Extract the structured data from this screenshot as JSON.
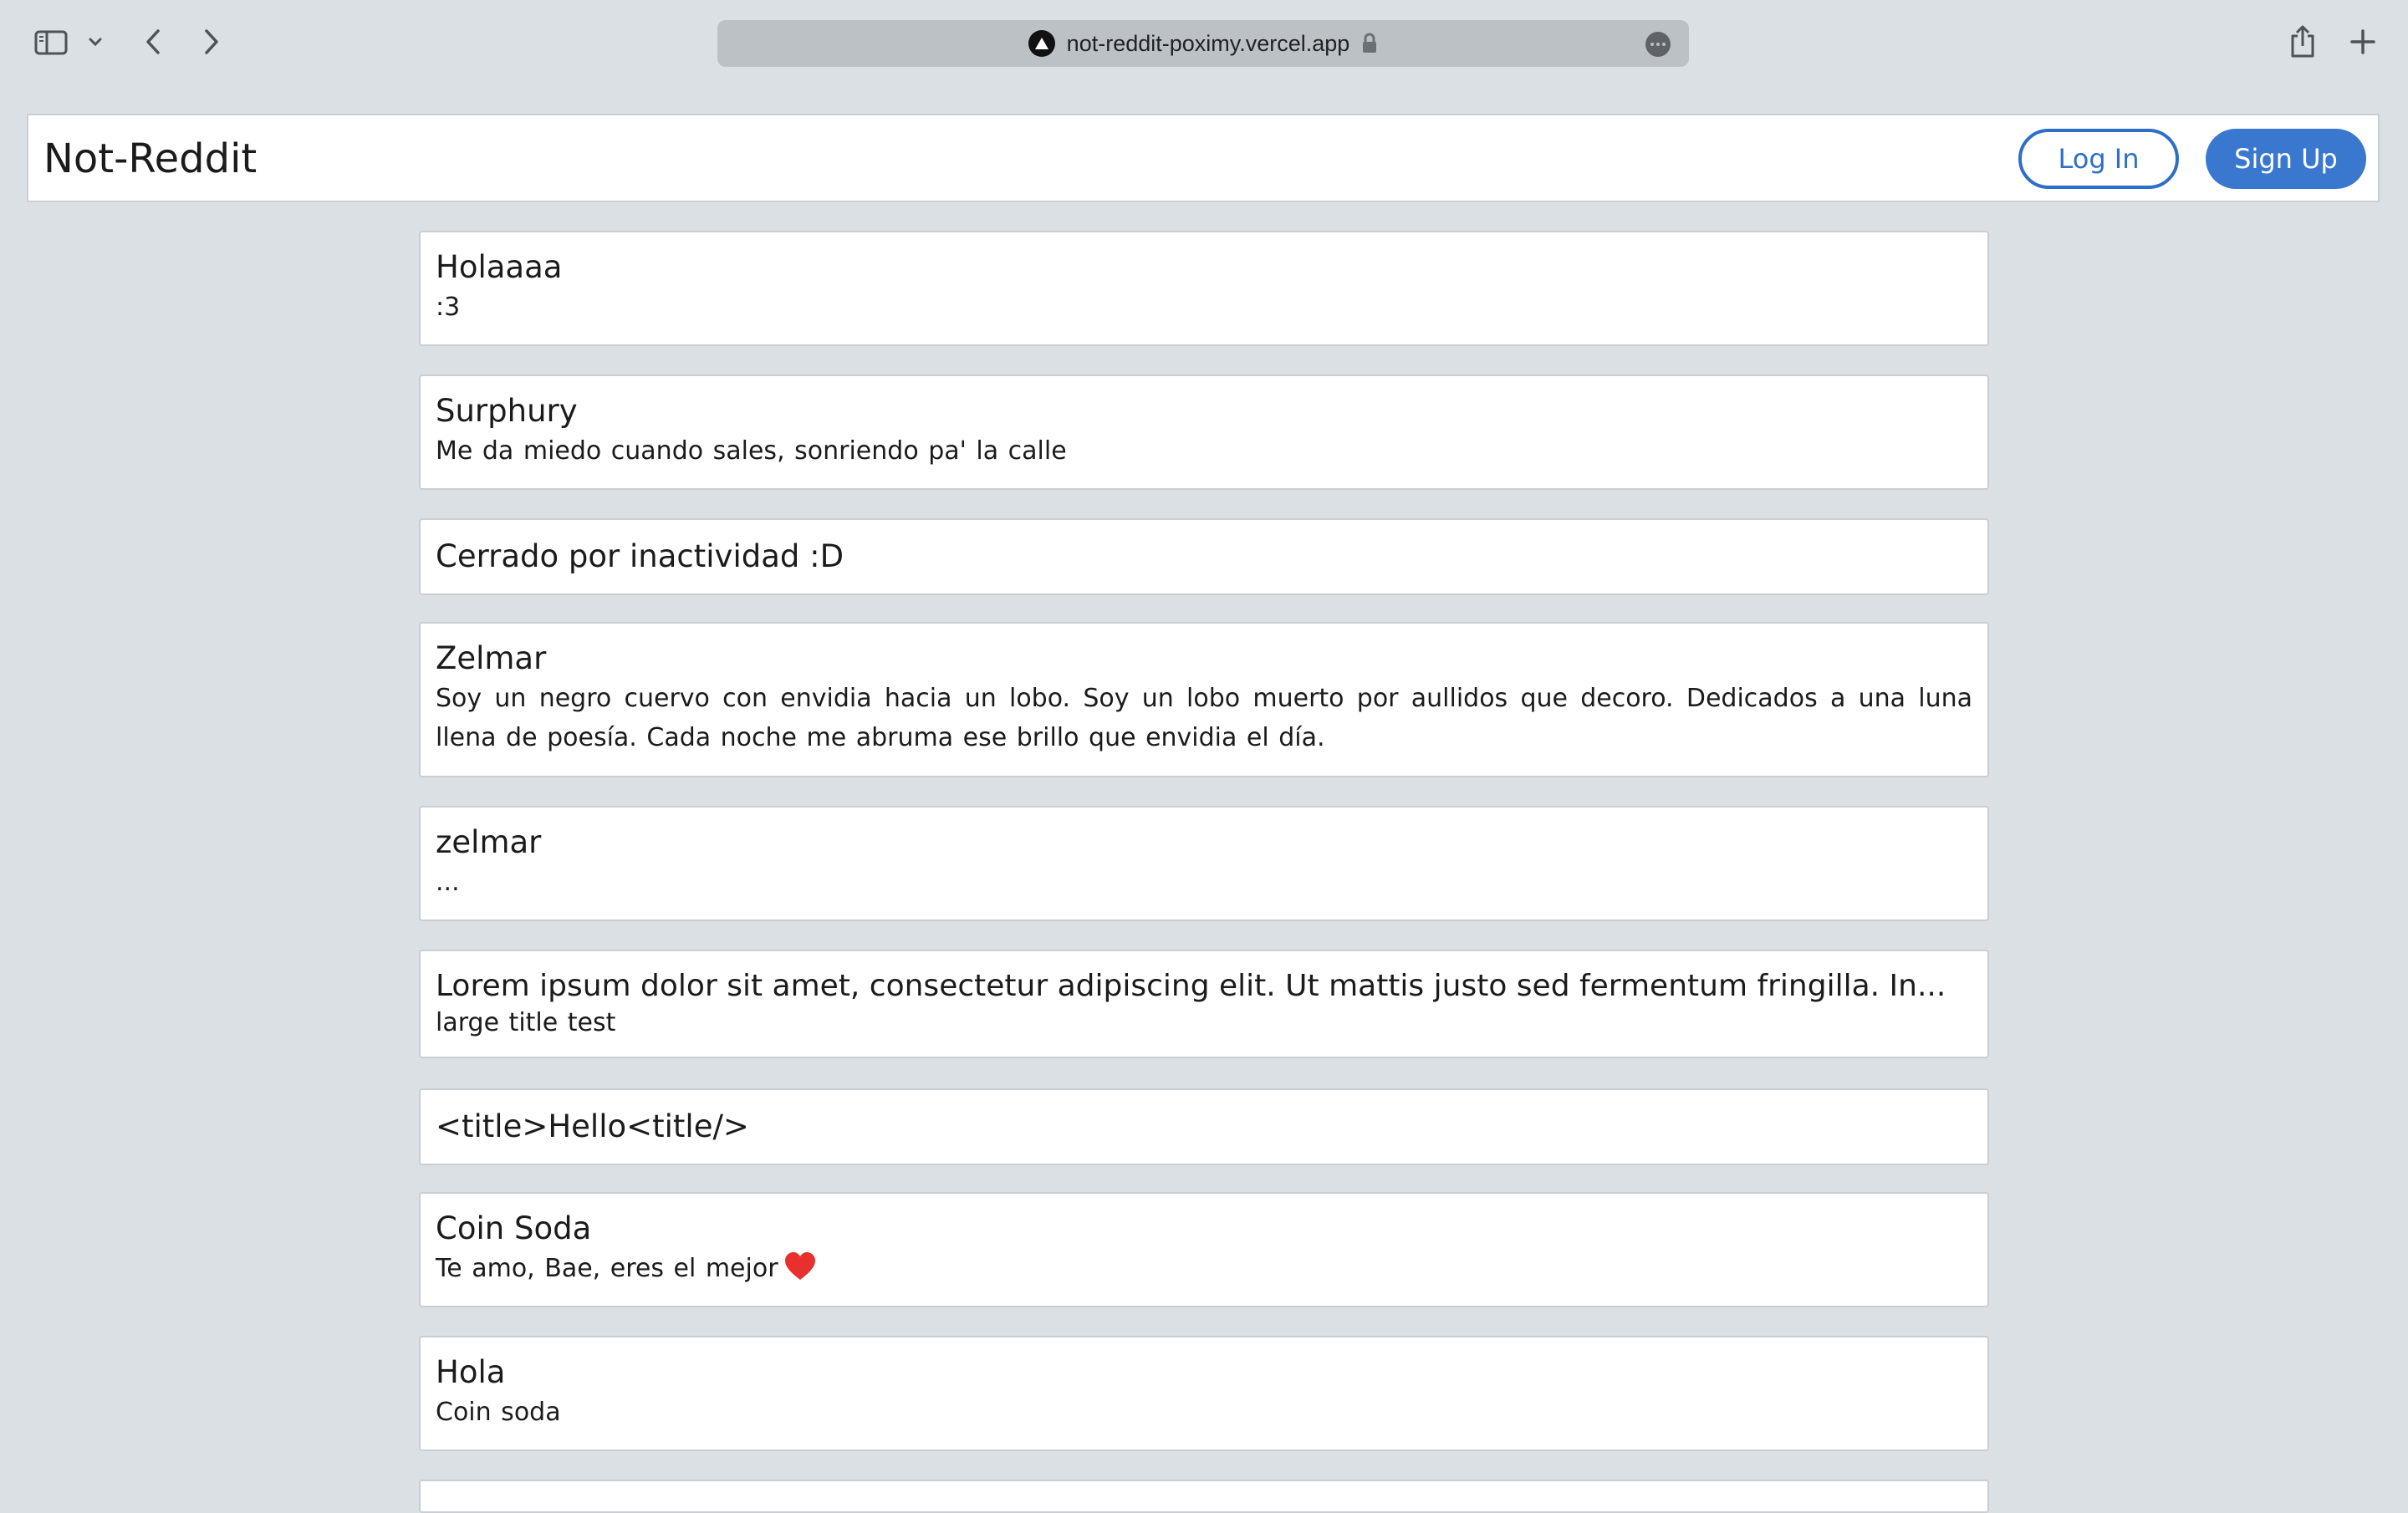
{
  "browser": {
    "url": "not-reddit-poximy.vercel.app"
  },
  "header": {
    "brand": "Not-Reddit",
    "login_label": "Log In",
    "signup_label": "Sign Up"
  },
  "posts": [
    {
      "title": "Holaaaa",
      "body": ":3"
    },
    {
      "title": "Surphury",
      "body": "Me da miedo cuando sales, sonriendo pa' la calle"
    },
    {
      "title": "Cerrado por inactividad :D",
      "body": ""
    },
    {
      "title": "Zelmar",
      "body": "Soy un negro cuervo con envidia hacia un lobo. Soy un lobo muerto por aullidos que decoro. Dedicados a una luna llena de poesía. Cada noche me abruma ese brillo que envidia el día."
    },
    {
      "title": "zelmar",
      "body": "..."
    },
    {
      "title": "Lorem ipsum dolor sit amet, consectetur adipiscing elit. Ut mattis justo sed fermentum fringilla. In...",
      "body": "large title test"
    },
    {
      "title": "<title>Hello<title/>",
      "body": ""
    },
    {
      "title": "Coin Soda",
      "body": "Te amo, Bae, eres el mejor"
    },
    {
      "title": "Hola",
      "body": "Coin soda"
    }
  ],
  "colors": {
    "accent": "#3a78cf",
    "page_background": "#dbe0e5",
    "heart": "#e8312f"
  }
}
